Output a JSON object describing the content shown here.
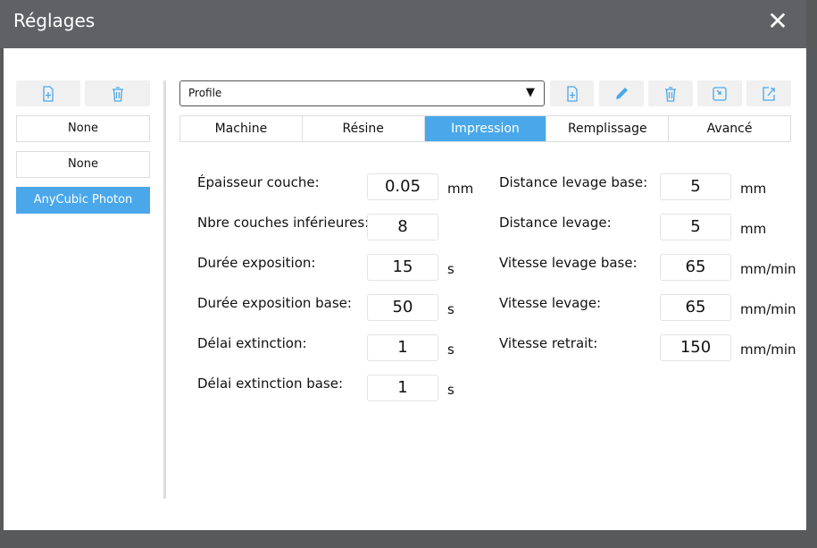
{
  "window": {
    "title": "Réglages"
  },
  "sidebar": {
    "items": [
      {
        "label": "None"
      },
      {
        "label": "None"
      },
      {
        "label": "AnyCubic Photon"
      }
    ]
  },
  "profile": {
    "selected": "Profile"
  },
  "tabs": [
    {
      "label": "Machine"
    },
    {
      "label": "Résine"
    },
    {
      "label": "Impression"
    },
    {
      "label": "Remplissage"
    },
    {
      "label": "Avancé"
    }
  ],
  "fields_left": [
    {
      "label": "Épaisseur couche:",
      "value": "0.05",
      "unit": "mm"
    },
    {
      "label": "Nbre couches inférieures:",
      "value": "8",
      "unit": ""
    },
    {
      "label": "Durée exposition:",
      "value": "15",
      "unit": "s"
    },
    {
      "label": "Durée exposition base:",
      "value": "50",
      "unit": "s"
    },
    {
      "label": "Délai extinction:",
      "value": "1",
      "unit": "s"
    },
    {
      "label": "Délai extinction base:",
      "value": "1",
      "unit": "s"
    }
  ],
  "fields_right": [
    {
      "label": "Distance levage base:",
      "value": "5",
      "unit": "mm"
    },
    {
      "label": "Distance levage:",
      "value": "5",
      "unit": "mm"
    },
    {
      "label": "Vitesse levage base:",
      "value": "65",
      "unit": "mm/min"
    },
    {
      "label": "Vitesse levage:",
      "value": "65",
      "unit": "mm/min"
    },
    {
      "label": "Vitesse retrait:",
      "value": "150",
      "unit": "mm/min"
    }
  ],
  "colors": {
    "accent": "#4aa8ea",
    "titlebar": "#606164"
  }
}
